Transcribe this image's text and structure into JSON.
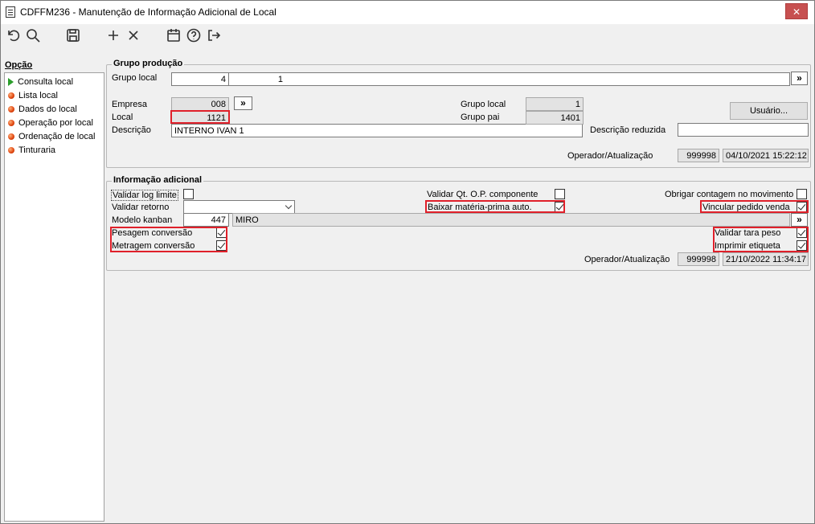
{
  "window": {
    "title": "CDFFM236 - Manutenção de Informação Adicional de Local",
    "close_label": "✕"
  },
  "sidebar": {
    "heading": "Opção",
    "items": [
      {
        "label": "Consulta local",
        "icon": "arrow-icon"
      },
      {
        "label": "Lista local",
        "icon": "dot-icon"
      },
      {
        "label": "Dados do local",
        "icon": "dot-icon"
      },
      {
        "label": "Operação por local",
        "icon": "dot-icon"
      },
      {
        "label": "Ordenação de local",
        "icon": "dot-icon"
      },
      {
        "label": "Tinturaria",
        "icon": "dot-icon"
      }
    ]
  },
  "producao": {
    "title": "Grupo produção",
    "grupo_local_label": "Grupo local",
    "grupo_local_a": "4",
    "grupo_local_b": "1",
    "chev": "»",
    "empresa_label": "Empresa",
    "empresa_value": "008",
    "local_label": "Local",
    "local_value": "1121",
    "descricao_label": "Descrição",
    "descricao_value": "INTERNO IVAN 1",
    "grupo_local_r_label": "Grupo local",
    "grupo_local_r_value": "1",
    "grupo_pai_label": "Grupo pai",
    "grupo_pai_value": "1401",
    "usuario_button": "Usuário...",
    "descricao_reduzida_label": "Descrição reduzida",
    "descricao_reduzida_value": "",
    "operador_label": "Operador/Atualização",
    "operador_value": "999998",
    "atualizacao_value": "04/10/2021 15:22:12"
  },
  "adicional": {
    "title": "Informação adicional",
    "validar_log_label": "Validar log limite",
    "validar_retorno_label": "Validar retorno",
    "validar_retorno_value": "",
    "modelo_kanban_label": "Modelo kanban",
    "modelo_kanban_value": "447",
    "modelo_kanban_desc": "MIRO",
    "pesagem_label": "Pesagem conversão",
    "metragem_label": "Metragem conversão",
    "validar_qt_label": "Validar Qt. O.P. componente",
    "baixar_label": "Baixar matéria-prima auto.",
    "obrigar_label": "Obrigar contagem no movimento",
    "vincular_label": "Vincular pedido venda",
    "validar_tara_label": "Validar tara peso",
    "imprimir_label": "Imprimir etiqueta",
    "operador_label": "Operador/Atualização",
    "operador_value": "999998",
    "atualizacao_value": "21/10/2022 11:34:17"
  }
}
